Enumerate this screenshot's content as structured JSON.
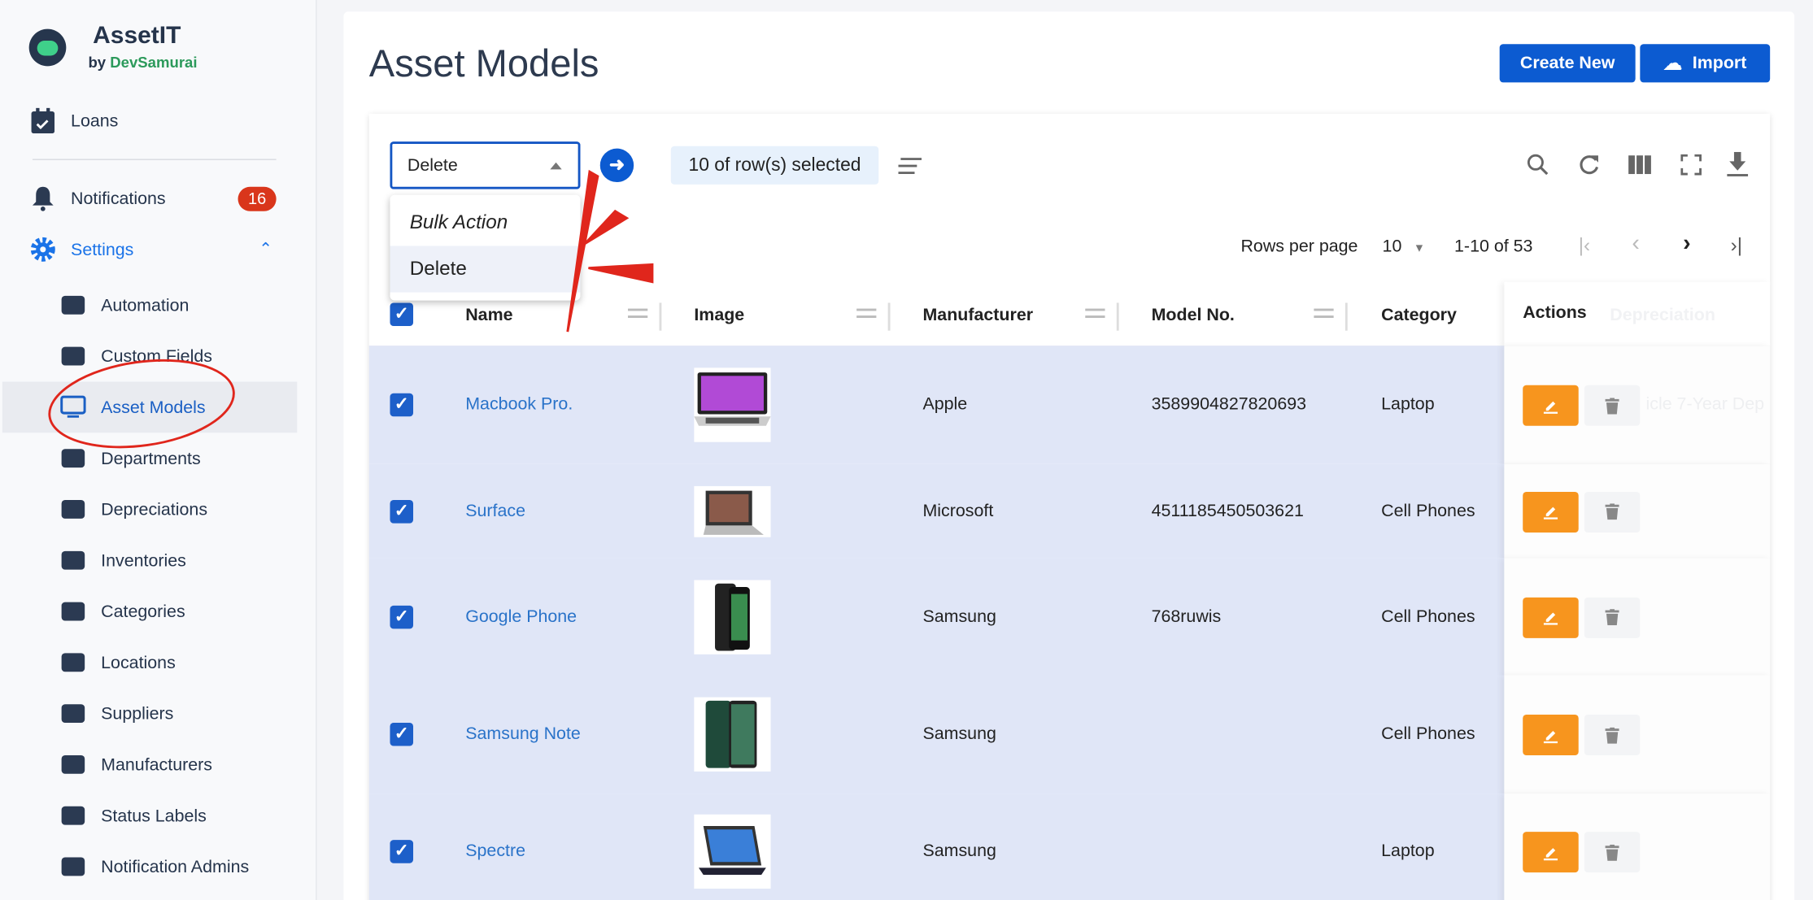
{
  "sidebar": {
    "brand": "AssetIT",
    "by": "by",
    "company": "DevSamurai",
    "loans": "Loans",
    "notifications": "Notifications",
    "notifications_count": "16",
    "settings": "Settings",
    "items": [
      {
        "label": "Automation",
        "icon": "automation-icon"
      },
      {
        "label": "Custom Fields",
        "icon": "custom-fields-icon"
      },
      {
        "label": "Asset Models",
        "icon": "monitor-icon",
        "selected": true
      },
      {
        "label": "Departments",
        "icon": "building-icon"
      },
      {
        "label": "Depreciations",
        "icon": "dollar-icon"
      },
      {
        "label": "Inventories",
        "icon": "warehouse-icon"
      },
      {
        "label": "Categories",
        "icon": "list-icon"
      },
      {
        "label": "Locations",
        "icon": "map-icon"
      },
      {
        "label": "Suppliers",
        "icon": "parachute-icon"
      },
      {
        "label": "Manufacturers",
        "icon": "factory-icon"
      },
      {
        "label": "Status Labels",
        "icon": "tag-icon"
      },
      {
        "label": "Notification Admins",
        "icon": "user-gear-icon"
      }
    ]
  },
  "header": {
    "title": "Asset Models",
    "create_new": "Create New",
    "import": "Import"
  },
  "toolbar": {
    "bulk_action_value": "Delete",
    "bulk_action_options": [
      "Bulk Action",
      "Delete"
    ],
    "selected_text": "10 of row(s) selected",
    "rows_per_page_label": "Rows per page",
    "rows_per_page": "10",
    "range": "1-10 of 53"
  },
  "table": {
    "columns": [
      "Name",
      "Image",
      "Manufacturer",
      "Model No.",
      "Category",
      "Actions",
      "Depreciation"
    ],
    "rows": [
      {
        "name": "Macbook Pro.",
        "image": "laptop",
        "manufacturer": "Apple",
        "model_no": "3589904827820693",
        "category": "Laptop",
        "depreciation": "icle 7-Year Dep"
      },
      {
        "name": "Surface",
        "image": "tablet",
        "manufacturer": "Microsoft",
        "model_no": "4511185450503621",
        "category": "Cell Phones"
      },
      {
        "name": "Google Phone",
        "image": "phone",
        "manufacturer": "Samsung",
        "model_no": "768ruwis",
        "category": "Cell Phones"
      },
      {
        "name": "Samsung Note",
        "image": "phone-green",
        "manufacturer": "Samsung",
        "model_no": "",
        "category": "Cell Phones"
      },
      {
        "name": "Spectre",
        "image": "convertible",
        "manufacturer": "Samsung",
        "model_no": "",
        "category": "Laptop"
      }
    ]
  },
  "colors": {
    "primary": "#0c5bd1",
    "edit": "#f7951e",
    "badge": "#d9361b",
    "row_selected": "#e0e6f7",
    "annotation": "#e0261c"
  }
}
